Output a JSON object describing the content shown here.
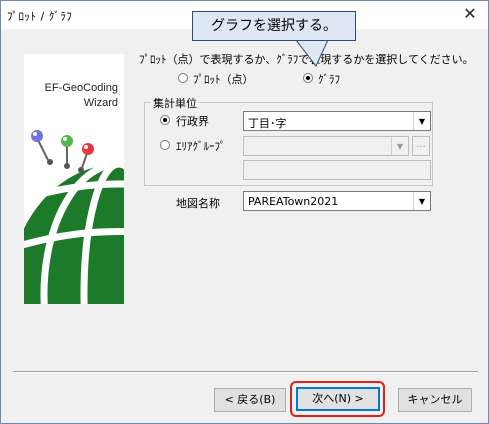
{
  "window": {
    "title": "ﾌﾟﾛｯﾄ / ｸﾞﾗﾌ",
    "close_glyph": "✕"
  },
  "callout": {
    "text": "グラフを選択する。"
  },
  "wizard": {
    "line1": "EF-GeoCoding",
    "line2": "Wizard"
  },
  "prompt": "ﾌﾟﾛｯﾄ（点）で表現するか、ｸﾞﾗﾌで表現するかを選択してください。",
  "mode": {
    "options": [
      {
        "label": "ﾌﾟﾛｯﾄ（点）",
        "selected": false
      },
      {
        "label": "ｸﾞﾗﾌ",
        "selected": true
      }
    ]
  },
  "aggregation": {
    "group_title": "集計単位",
    "admin": {
      "label": "行政界",
      "selected": true,
      "value": "丁目･字"
    },
    "area_group": {
      "label": "ｴﾘｱｸﾞﾙｰﾌﾟ",
      "selected": false,
      "value": "",
      "browse": "..."
    }
  },
  "map_name": {
    "label": "地図名称",
    "value": "PAREATown2021"
  },
  "buttons": {
    "back": "< 戻る(B)",
    "next": "次へ(N) >",
    "cancel": "キャンセル"
  },
  "colors": {
    "accent_red": "#e0201a",
    "globe_green": "#1d7a2b",
    "callout_fill": "#dde8f4"
  }
}
